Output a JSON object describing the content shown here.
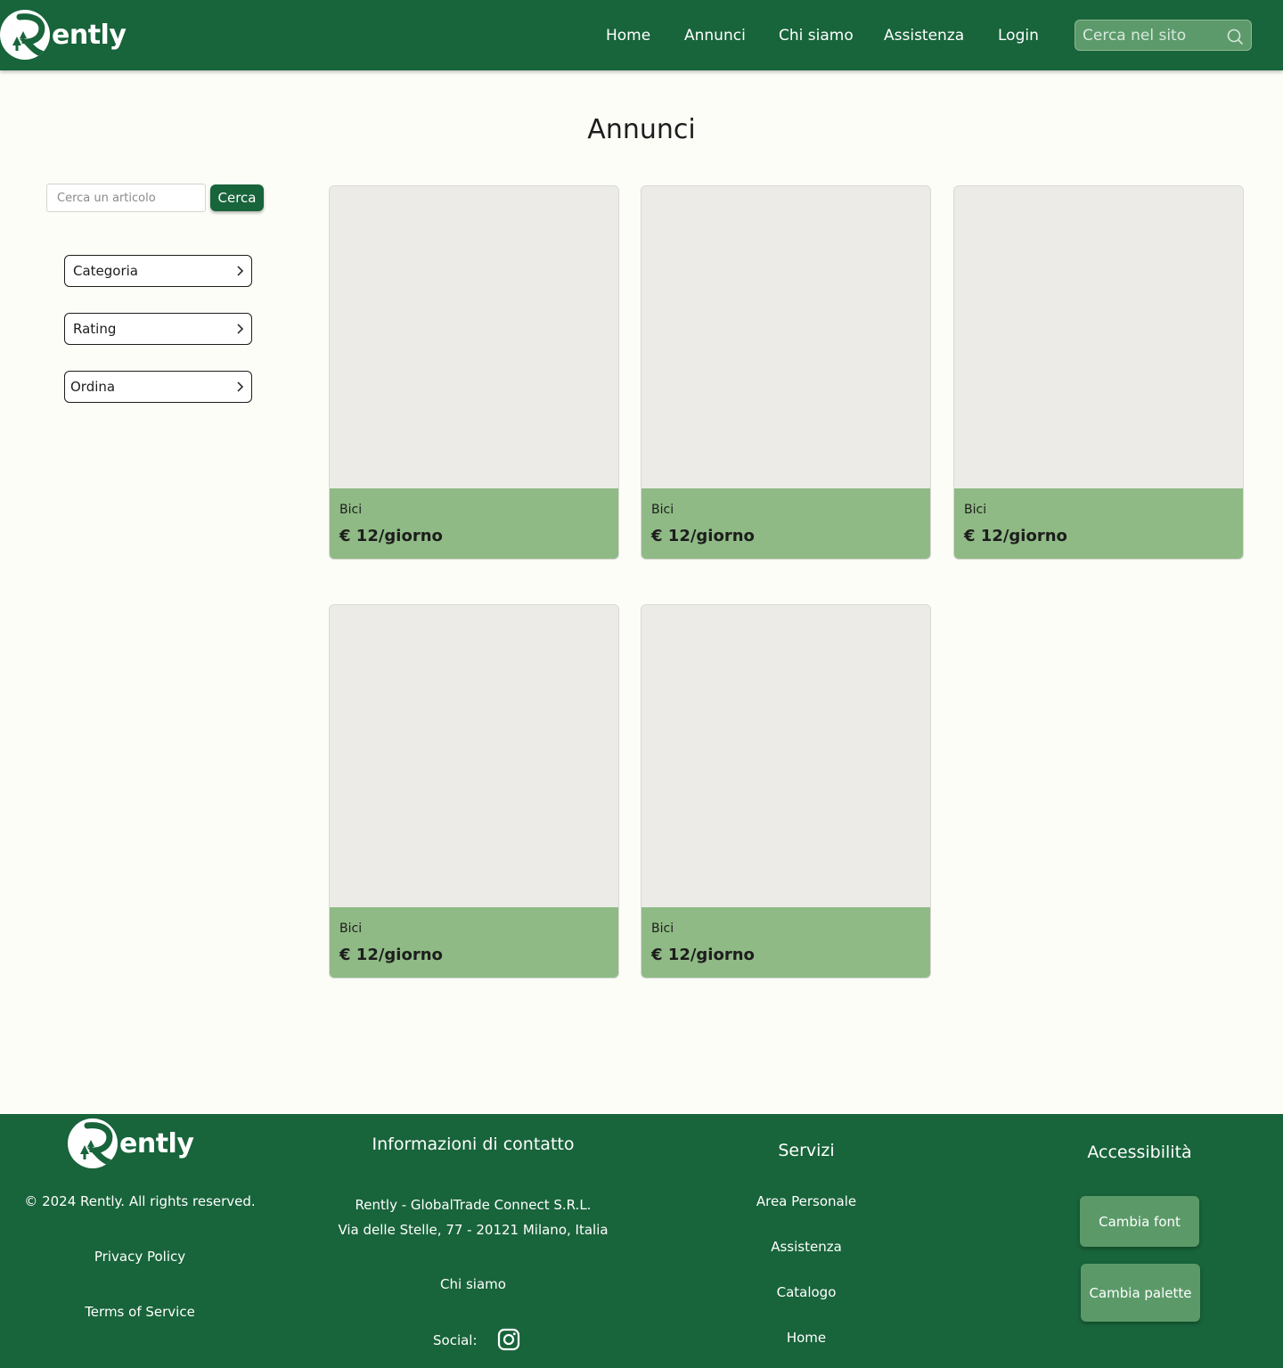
{
  "header": {
    "logo_text": "ently",
    "nav": [
      "Home",
      "Annunci",
      "Chi siamo",
      "Assistenza",
      "Login"
    ],
    "search_placeholder": "Cerca nel sito"
  },
  "main": {
    "title": "Annunci",
    "article_search_placeholder": "Cerca un articolo",
    "search_button": "Cerca",
    "filters": [
      "Categoria",
      "Rating",
      "Ordina"
    ],
    "listings": [
      {
        "category": "Bici",
        "price": "€ 12/giorno"
      },
      {
        "category": "Bici",
        "price": "€ 12/giorno"
      },
      {
        "category": "Bici",
        "price": "€ 12/giorno"
      },
      {
        "category": "Bici",
        "price": "€ 12/giorno"
      },
      {
        "category": "Bici",
        "price": "€ 12/giorno"
      }
    ]
  },
  "footer": {
    "logo_text": "ently",
    "copyright": "© 2024 Rently. All rights reserved.",
    "privacy": "Privacy Policy",
    "terms": "Terms of Service",
    "contact_heading": "Informazioni di contatto",
    "company": "Rently - GlobalTrade Connect S.R.L.",
    "address": "Via delle Stelle, 77 - 20121 Milano, Italia",
    "about": "Chi siamo",
    "social_label": "Social:",
    "services_heading": "Servizi",
    "services": [
      "Area Personale",
      "Assistenza",
      "Catalogo",
      "Home"
    ],
    "accessibility_heading": "Accessibilità",
    "change_font": "Cambia font",
    "change_palette": "Cambia palette"
  },
  "colors": {
    "primary": "#18643b",
    "card_info": "#8fba85",
    "card_image": "#ecebe8",
    "background": "#fdfdf8",
    "button_secondary": "#5b9a68"
  }
}
